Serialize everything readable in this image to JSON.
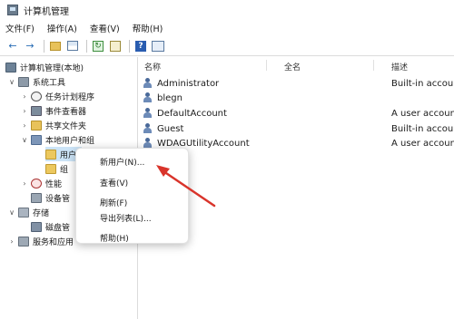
{
  "window": {
    "title": "计算机管理"
  },
  "menubar": [
    "文件(F)",
    "操作(A)",
    "查看(V)",
    "帮助(H)"
  ],
  "toolbar": {
    "back_icon": "back-arrow-icon",
    "forward_icon": "forward-arrow-icon",
    "help_glyph": "?"
  },
  "tree": {
    "root": "计算机管理(本地)",
    "system_tools": "系统工具",
    "task_scheduler": "任务计划程序",
    "event_viewer": "事件查看器",
    "shared_folders": "共享文件夹",
    "local_users_groups": "本地用户和组",
    "users": "用户",
    "groups": "组",
    "performance": "性能",
    "device_manager": "设备管",
    "storage": "存储",
    "disk_management": "磁盘管",
    "services_apps": "服务和应用"
  },
  "list": {
    "headers": {
      "name": "名称",
      "fullname": "全名",
      "description": "描述"
    },
    "users": [
      {
        "name": "Administrator",
        "description": "Built-in account"
      },
      {
        "name": "blegn",
        "description": ""
      },
      {
        "name": "DefaultAccount",
        "description": "A user account"
      },
      {
        "name": "Guest",
        "description": "Built-in account"
      },
      {
        "name": "WDAGUtilityAccount",
        "description": "A user account"
      }
    ]
  },
  "context_menu": {
    "new_user": "新用户(N)...",
    "view": "查看(V)",
    "refresh": "刷新(F)",
    "export_list": "导出列表(L)...",
    "help": "帮助(H)"
  },
  "colors": {
    "arrow": "#d9342b",
    "selection": "#cce4f7"
  }
}
